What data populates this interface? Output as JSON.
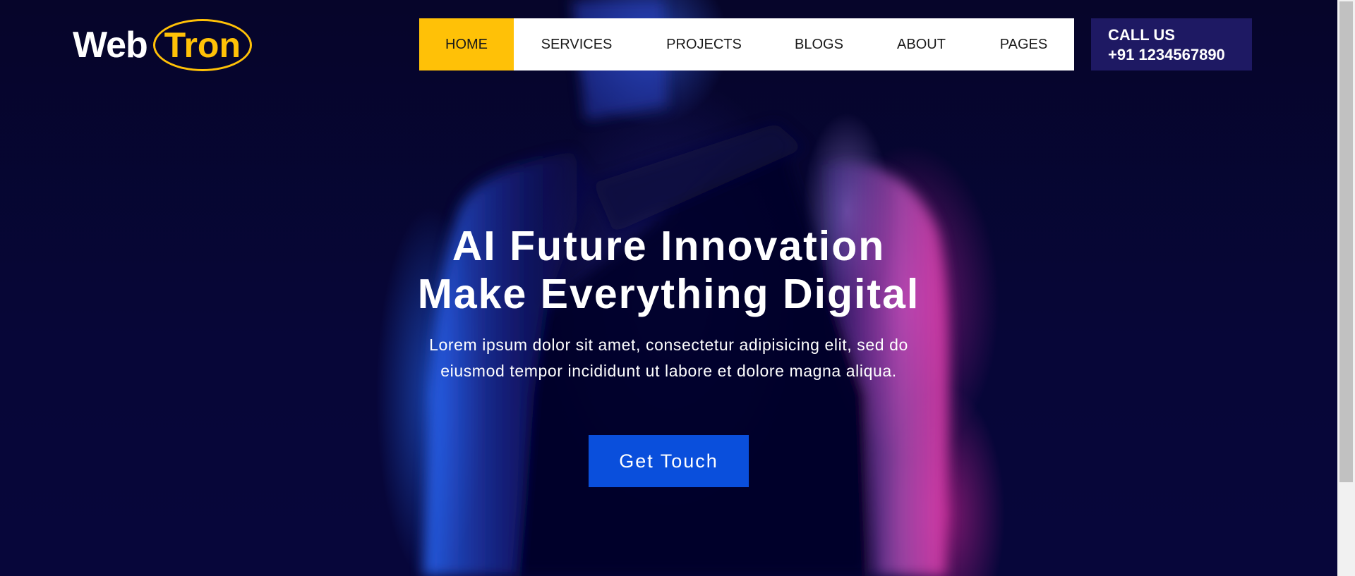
{
  "brand": {
    "logo_part1": "Web",
    "logo_part2": "Tron",
    "accent_color": "#ffc107",
    "call_box_color": "#1e1963",
    "cta_color": "#0a4fdc"
  },
  "nav": {
    "items": [
      {
        "label": "HOME",
        "active": true
      },
      {
        "label": "SERVICES",
        "active": false
      },
      {
        "label": "PROJECTS",
        "active": false
      },
      {
        "label": "BLOGS",
        "active": false
      },
      {
        "label": "ABOUT",
        "active": false
      },
      {
        "label": "PAGES",
        "active": false
      }
    ]
  },
  "call": {
    "label": "CALL US",
    "phone": "+91 1234567890"
  },
  "hero": {
    "title_line1": "AI Future Innovation",
    "title_line2": "Make Everything Digital",
    "text": "Lorem ipsum dolor sit amet, consectetur adipisicing elit, sed do eiusmod tempor incididunt ut labore et dolore magna aliqua.",
    "cta_label": "Get Touch"
  }
}
